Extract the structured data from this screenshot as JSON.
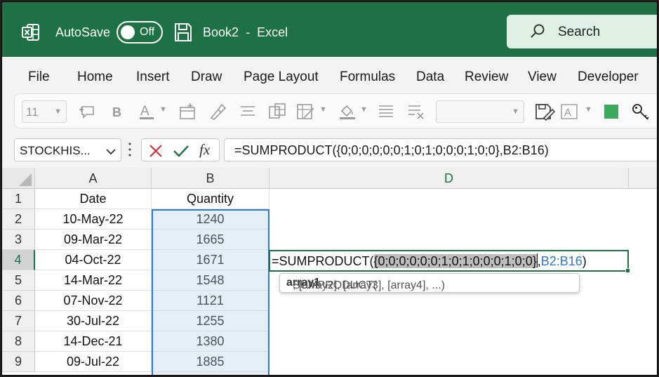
{
  "titlebar": {
    "autosave_label": "AutoSave",
    "autosave_state": "Off",
    "doc_name": "Book2",
    "separator": "-",
    "app_name": "Excel",
    "search_placeholder": "Search"
  },
  "menu": [
    "File",
    "Home",
    "Insert",
    "Draw",
    "Page Layout",
    "Formulas",
    "Data",
    "Review",
    "View",
    "Developer"
  ],
  "ribbon": {
    "font_size": "11",
    "icons": [
      "comment-icon",
      "bold-icon",
      "font-color-icon",
      "insert-cells-icon",
      "format-painter-icon",
      "align-icon",
      "table-icon",
      "format-table-icon",
      "fill-color-icon",
      "wrap-icon",
      "clear-icon",
      "cell-styles-icon",
      "text-box-icon",
      "green-swatch-icon",
      "key-icon"
    ]
  },
  "formula_bar": {
    "name_box": "STOCKHIS...",
    "fx": "fx",
    "formula": "=SUMPRODUCT({0;0;0;0;0;0;1;0;1;0;0;0;1;0;0},B2:B16)"
  },
  "grid": {
    "columns": [
      "A",
      "B",
      "D"
    ],
    "rows": [
      "1",
      "2",
      "3",
      "4",
      "5",
      "6",
      "7",
      "8",
      "9"
    ],
    "headers": {
      "a": "Date",
      "b": "Quantity"
    },
    "data": [
      {
        "date": "10-May-22",
        "qty": "1240"
      },
      {
        "date": "09-Mar-22",
        "qty": "1665"
      },
      {
        "date": "04-Oct-22",
        "qty": "1671"
      },
      {
        "date": "14-Mar-22",
        "qty": "1548"
      },
      {
        "date": "07-Nov-22",
        "qty": "1121"
      },
      {
        "date": "30-Jul-22",
        "qty": "1255"
      },
      {
        "date": "14-Dec-21",
        "qty": "1380"
      },
      {
        "date": "09-Jul-22",
        "qty": "1885"
      }
    ],
    "edit": {
      "prefix": "=SUMPRODUCT(",
      "array": "{0;0;0;0;0;0;1;0;1;0;0;0;1;0;0}",
      "comma": ",",
      "range": "B2:B16",
      "suffix": ")"
    },
    "tooltip": {
      "fn": "SUMPRODUCT(",
      "arg1": "array1",
      "rest": ", [array2], [array3], [array4], ...)"
    }
  },
  "colors": {
    "excel_green": "#1e7145",
    "ref_blue": "#2e79c8"
  }
}
